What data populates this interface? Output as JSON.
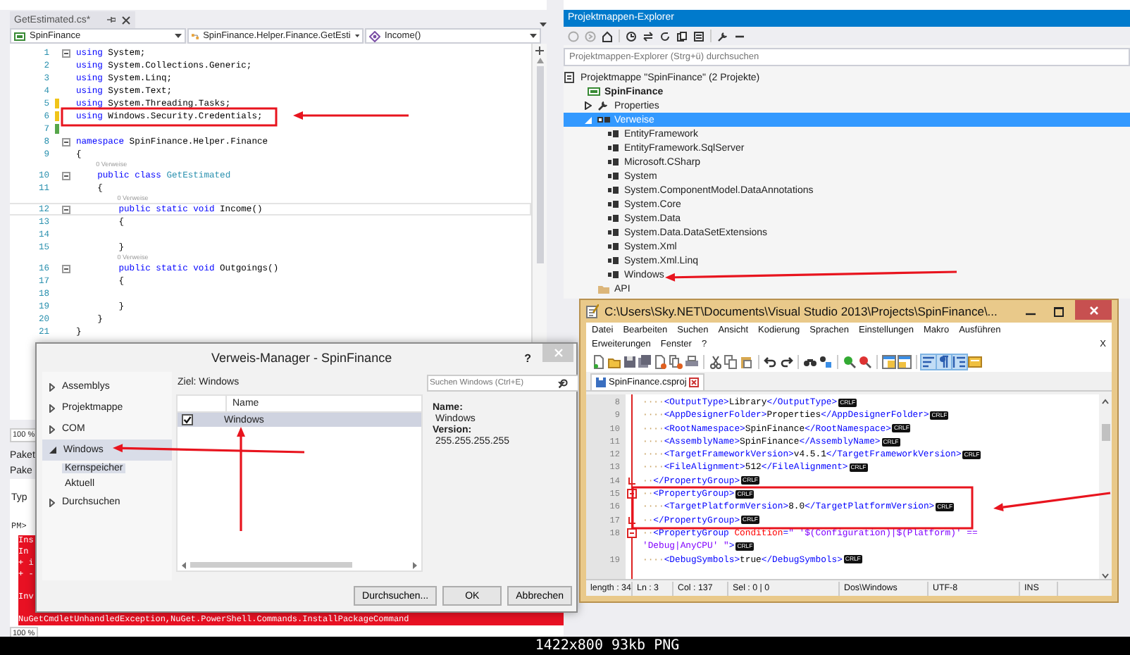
{
  "editor": {
    "tab": "GetEstimated.cs*",
    "nav": [
      {
        "kind": "project",
        "label": "SpinFinance"
      },
      {
        "kind": "class",
        "label": "SpinFinance.Helper.Finance.GetEsti"
      },
      {
        "kind": "method",
        "label": "Income()"
      }
    ],
    "lines": [
      {
        "kind": "code",
        "number": "1",
        "fold": true,
        "changed": false,
        "current": false,
        "tokens": [
          {
            "kind": "kw",
            "text": "using"
          },
          {
            "kind": "text",
            "text": " System;"
          }
        ]
      },
      {
        "kind": "code",
        "number": "2",
        "fold": false,
        "changed": false,
        "current": false,
        "tokens": [
          {
            "kind": "kw",
            "text": "using"
          },
          {
            "kind": "text",
            "text": " System.Collections.Generic;"
          }
        ]
      },
      {
        "kind": "code",
        "number": "3",
        "fold": false,
        "changed": false,
        "current": false,
        "tokens": [
          {
            "kind": "kw",
            "text": "using"
          },
          {
            "kind": "text",
            "text": " System.Linq;"
          }
        ]
      },
      {
        "kind": "code",
        "number": "4",
        "fold": false,
        "changed": false,
        "current": false,
        "tokens": [
          {
            "kind": "kw",
            "text": "using"
          },
          {
            "kind": "text",
            "text": " System.Text;"
          }
        ]
      },
      {
        "kind": "code",
        "number": "5",
        "fold": false,
        "changed": true,
        "saved": false,
        "current": false,
        "tokens": [
          {
            "kind": "kw",
            "text": "using"
          },
          {
            "kind": "text",
            "text": " System.Threading.Tasks;"
          }
        ]
      },
      {
        "kind": "code",
        "number": "6",
        "fold": false,
        "changed": true,
        "saved": false,
        "current": false,
        "tokens": [
          {
            "kind": "kw",
            "text": "using"
          },
          {
            "kind": "text",
            "text": " Windows.Security.Credentials;"
          }
        ]
      },
      {
        "kind": "code",
        "number": "7",
        "fold": false,
        "changed": true,
        "saved": true,
        "current": false
      },
      {
        "kind": "code",
        "number": "8",
        "fold": true,
        "changed": false,
        "current": false,
        "tokens": [
          {
            "kind": "kw",
            "text": "namespace"
          },
          {
            "kind": "text",
            "text": " SpinFinance.Helper.Finance"
          }
        ]
      },
      {
        "kind": "code",
        "number": "9",
        "fold": false,
        "changed": false,
        "current": false,
        "tokens": [
          {
            "kind": "text",
            "text": "{"
          }
        ]
      },
      {
        "kind": "lens",
        "text": "0 Verweise"
      },
      {
        "kind": "code",
        "number": "10",
        "fold": true,
        "changed": false,
        "current": false,
        "tokens": [
          {
            "kind": "kw",
            "text": "    public class "
          },
          {
            "kind": "type",
            "text": "GetEstimated"
          }
        ]
      },
      {
        "kind": "code",
        "number": "11",
        "fold": false,
        "changed": false,
        "current": false,
        "tokens": [
          {
            "kind": "text",
            "text": "    {"
          }
        ]
      },
      {
        "kind": "lens",
        "text": "0 Verweise"
      },
      {
        "kind": "code",
        "number": "12",
        "fold": true,
        "changed": false,
        "current": true,
        "tokens": [
          {
            "kind": "kw",
            "text": "        public static void "
          },
          {
            "kind": "text",
            "text": "Income()"
          }
        ]
      },
      {
        "kind": "code",
        "number": "13",
        "fold": false,
        "changed": false,
        "current": false,
        "tokens": [
          {
            "kind": "text",
            "text": "        {"
          }
        ]
      },
      {
        "kind": "code",
        "number": "14",
        "fold": false,
        "changed": false,
        "current": false
      },
      {
        "kind": "code",
        "number": "15",
        "fold": false,
        "changed": false,
        "current": false,
        "tokens": [
          {
            "kind": "text",
            "text": "        }"
          }
        ]
      },
      {
        "kind": "lens",
        "text": "0 Verweise"
      },
      {
        "kind": "code",
        "number": "16",
        "fold": true,
        "changed": false,
        "current": false,
        "tokens": [
          {
            "kind": "kw",
            "text": "        public static void "
          },
          {
            "kind": "text",
            "text": "Outgoings()"
          }
        ]
      },
      {
        "kind": "code",
        "number": "17",
        "fold": false,
        "changed": false,
        "current": false,
        "tokens": [
          {
            "kind": "text",
            "text": "        {"
          }
        ]
      },
      {
        "kind": "code",
        "number": "18",
        "fold": false,
        "changed": false,
        "current": false
      },
      {
        "kind": "code",
        "number": "19",
        "fold": false,
        "changed": false,
        "current": false,
        "tokens": [
          {
            "kind": "text",
            "text": "        }"
          }
        ]
      },
      {
        "kind": "code",
        "number": "20",
        "fold": false,
        "changed": false,
        "current": false,
        "tokens": [
          {
            "kind": "text",
            "text": "    }"
          }
        ]
      },
      {
        "kind": "code",
        "number": "21",
        "fold": false,
        "changed": false,
        "current": false,
        "tokens": [
          {
            "kind": "text",
            "text": "}"
          }
        ]
      }
    ]
  },
  "output": {
    "zoom": "100 %",
    "tabs": [
      "Paket",
      "Pake"
    ],
    "type_label": "Typ",
    "lines": [
      {
        "kind": "prompt",
        "text": "PM>"
      },
      {
        "kind": "error",
        "text": "Ins"
      },
      {
        "kind": "error",
        "text": "In"
      },
      {
        "kind": "error",
        "text": "+ i"
      },
      {
        "kind": "error",
        "text": "+ -"
      },
      {
        "kind": "error-blank"
      },
      {
        "kind": "error",
        "text": "Inv"
      },
      {
        "kind": "error-blank"
      },
      {
        "kind": "error",
        "text": "NuGetCmdletUnhandledException,NuGet.PowerShell.Commands.InstallPackageCommand"
      }
    ],
    "footer_zoom": "100 %"
  },
  "explorer": {
    "title": "Projektmappen-Explorer",
    "search": {
      "placeholder": "Projektmappen-Explorer (Strg+ü) durchsuchen"
    },
    "tree": [
      {
        "label": "Projektmappe \"SpinFinance\" (2 Projekte)",
        "kind": "solution",
        "selected": false,
        "children": [
          {
            "label": "SpinFinance",
            "kind": "project",
            "startup": true,
            "selected": false,
            "children": [
              {
                "label": "Properties",
                "kind": "properties",
                "expanded": false,
                "selected": false
              },
              {
                "label": "Verweise",
                "kind": "references",
                "expanded": true,
                "selected": true,
                "children": [
                  {
                    "label": "EntityFramework",
                    "kind": "reference",
                    "selected": false
                  },
                  {
                    "label": "EntityFramework.SqlServer",
                    "kind": "reference",
                    "selected": false
                  },
                  {
                    "label": "Microsoft.CSharp",
                    "kind": "reference",
                    "selected": false
                  },
                  {
                    "label": "System",
                    "kind": "reference",
                    "selected": false
                  },
                  {
                    "label": "System.ComponentModel.DataAnnotations",
                    "kind": "reference",
                    "selected": false
                  },
                  {
                    "label": "System.Core",
                    "kind": "reference",
                    "selected": false
                  },
                  {
                    "label": "System.Data",
                    "kind": "reference",
                    "selected": false
                  },
                  {
                    "label": "System.Data.DataSetExtensions",
                    "kind": "reference",
                    "selected": false
                  },
                  {
                    "label": "System.Xml",
                    "kind": "reference",
                    "selected": false
                  },
                  {
                    "label": "System.Xml.Linq",
                    "kind": "reference",
                    "selected": false
                  },
                  {
                    "label": "Windows",
                    "kind": "reference",
                    "selected": false
                  }
                ]
              },
              {
                "label": "API",
                "kind": "folder",
                "selected": false
              }
            ]
          }
        ]
      }
    ]
  },
  "dialog": {
    "title": "Verweis-Manager - SpinFinance",
    "help": "?",
    "nav": [
      {
        "label": "Assemblys",
        "expanded": false,
        "selected": false
      },
      {
        "label": "Projektmappe",
        "expanded": false,
        "selected": false
      },
      {
        "label": "COM",
        "expanded": false,
        "selected": false
      },
      {
        "label": "Windows",
        "expanded": true,
        "selected": true,
        "children": [
          {
            "label": "Kernspeicher",
            "selected": true
          },
          {
            "label": "Aktuell",
            "selected": false
          }
        ]
      },
      {
        "label": "Durchsuchen",
        "expanded": false,
        "selected": false
      }
    ],
    "target": "Ziel: Windows",
    "columns": [
      "Name"
    ],
    "rows": [
      {
        "name": "Windows",
        "checked": true,
        "selected": true
      }
    ],
    "search": {
      "placeholder": "Suchen Windows (Ctrl+E)"
    },
    "details": [
      {
        "label": "Name:",
        "value": "Windows"
      },
      {
        "label": "Version:",
        "value": "255.255.255.255"
      }
    ],
    "buttons": [
      "Durchsuchen...",
      "OK",
      "Abbrechen"
    ]
  },
  "notepad": {
    "title": "C:\\Users\\Sky.NET\\Documents\\Visual Studio 2013\\Projects\\SpinFinance\\...",
    "menu": [
      [
        "Datei",
        "Bearbeiten",
        "Suchen",
        "Ansicht",
        "Kodierung",
        "Sprachen",
        "Einstellungen",
        "Makro",
        "Ausführen"
      ],
      [
        "Erweiterungen",
        "Fenster",
        "?"
      ]
    ],
    "menu_close": "X",
    "toolbar": [
      [
        {
          "kind": "new",
          "on": false
        },
        {
          "kind": "open",
          "on": false
        },
        {
          "kind": "save",
          "on": false
        },
        {
          "kind": "save-all",
          "on": false
        },
        {
          "kind": "close",
          "on": false
        },
        {
          "kind": "close-all",
          "on": false
        },
        {
          "kind": "print",
          "on": false
        }
      ],
      [
        {
          "kind": "cut",
          "on": false
        },
        {
          "kind": "copy",
          "on": false
        },
        {
          "kind": "paste",
          "on": false
        }
      ],
      [
        {
          "kind": "undo",
          "on": false
        },
        {
          "kind": "redo",
          "on": false
        }
      ],
      [
        {
          "kind": "find",
          "on": false
        },
        {
          "kind": "replace",
          "on": false
        }
      ],
      [
        {
          "kind": "zoom-in",
          "on": false
        },
        {
          "kind": "zoom-out",
          "on": false
        }
      ],
      [
        {
          "kind": "sync-v",
          "on": false
        },
        {
          "kind": "sync-h",
          "on": false
        }
      ],
      [
        {
          "kind": "wrap",
          "on": true
        },
        {
          "kind": "all-chars",
          "on": true
        },
        {
          "kind": "indent-guide",
          "on": true
        },
        {
          "kind": "map",
          "on": false
        }
      ]
    ],
    "tab": "SpinFinance.csproj",
    "lines": [
      {
        "number": "8",
        "fold_start": false,
        "fold_end": false,
        "tokens": [
          {
            "kind": "ws",
            "text": "····"
          },
          {
            "kind": "tag",
            "text": "<OutputType>"
          },
          {
            "kind": "text",
            "text": "Library"
          },
          {
            "kind": "tag",
            "text": "</OutputType>"
          },
          {
            "kind": "eol",
            "text": "CRLF"
          }
        ]
      },
      {
        "number": "9",
        "fold_start": false,
        "fold_end": false,
        "tokens": [
          {
            "kind": "ws",
            "text": "····"
          },
          {
            "kind": "tag",
            "text": "<AppDesignerFolder>"
          },
          {
            "kind": "text",
            "text": "Properties"
          },
          {
            "kind": "tag",
            "text": "</AppDesignerFolder>"
          },
          {
            "kind": "eol",
            "text": "CRLF"
          }
        ]
      },
      {
        "number": "10",
        "fold_start": false,
        "fold_end": false,
        "tokens": [
          {
            "kind": "ws",
            "text": "····"
          },
          {
            "kind": "tag",
            "text": "<RootNamespace>"
          },
          {
            "kind": "text",
            "text": "SpinFinance"
          },
          {
            "kind": "tag",
            "text": "</RootNamespace>"
          },
          {
            "kind": "eol",
            "text": "CRLF"
          }
        ]
      },
      {
        "number": "11",
        "fold_start": false,
        "fold_end": false,
        "tokens": [
          {
            "kind": "ws",
            "text": "····"
          },
          {
            "kind": "tag",
            "text": "<AssemblyName>"
          },
          {
            "kind": "text",
            "text": "SpinFinance"
          },
          {
            "kind": "tag",
            "text": "</AssemblyName>"
          },
          {
            "kind": "eol",
            "text": "CRLF"
          }
        ]
      },
      {
        "number": "12",
        "fold_start": false,
        "fold_end": false,
        "tokens": [
          {
            "kind": "ws",
            "text": "····"
          },
          {
            "kind": "tag",
            "text": "<TargetFrameworkVersion>"
          },
          {
            "kind": "text",
            "text": "v4.5.1"
          },
          {
            "kind": "tag",
            "text": "</TargetFrameworkVersion>"
          },
          {
            "kind": "eol",
            "text": "CRLF"
          }
        ]
      },
      {
        "number": "13",
        "fold_start": false,
        "fold_end": false,
        "tokens": [
          {
            "kind": "ws",
            "text": "····"
          },
          {
            "kind": "tag",
            "text": "<FileAlignment>"
          },
          {
            "kind": "text",
            "text": "512"
          },
          {
            "kind": "tag",
            "text": "</FileAlignment>"
          },
          {
            "kind": "eol",
            "text": "CRLF"
          }
        ]
      },
      {
        "number": "14",
        "fold_start": false,
        "fold_end": true,
        "tokens": [
          {
            "kind": "ws",
            "text": "··"
          },
          {
            "kind": "tag",
            "text": "</PropertyGroup>"
          },
          {
            "kind": "eol",
            "text": "CRLF"
          }
        ]
      },
      {
        "number": "15",
        "fold_start": true,
        "fold_end": false,
        "tokens": [
          {
            "kind": "ws",
            "text": "··"
          },
          {
            "kind": "tag",
            "text": "<PropertyGroup>"
          },
          {
            "kind": "eol",
            "text": "CRLF"
          }
        ]
      },
      {
        "number": "16",
        "fold_start": false,
        "fold_end": false,
        "tokens": [
          {
            "kind": "ws",
            "text": "····"
          },
          {
            "kind": "tag",
            "text": "<TargetPlatformVersion>"
          },
          {
            "kind": "text",
            "text": "8.0"
          },
          {
            "kind": "tag",
            "text": "</TargetPlatformVersion>"
          },
          {
            "kind": "eol",
            "text": "CRLF"
          }
        ]
      },
      {
        "number": "17",
        "fold_start": false,
        "fold_end": true,
        "tokens": [
          {
            "kind": "ws",
            "text": "··"
          },
          {
            "kind": "tag",
            "text": "</PropertyGroup>"
          },
          {
            "kind": "eol",
            "text": "CRLF"
          }
        ]
      },
      {
        "number": "18",
        "fold_start": true,
        "fold_end": false,
        "tokens": [
          {
            "kind": "ws",
            "text": "··"
          },
          {
            "kind": "tag",
            "text": "<PropertyGroup "
          },
          {
            "kind": "attr",
            "text": "Condition"
          },
          {
            "kind": "tag",
            "text": "="
          },
          {
            "kind": "str",
            "text": "\" '$(Configuration)|$(Platform)' =="
          }
        ],
        "wrapped": [
          {
            "kind": "str",
            "text": "'Debug|AnyCPU' \""
          },
          {
            "kind": "tag",
            "text": ">"
          },
          {
            "kind": "eol",
            "text": "CRLF"
          }
        ]
      },
      {
        "number": "19",
        "fold_start": false,
        "fold_end": false,
        "tokens": [
          {
            "kind": "ws",
            "text": "····"
          },
          {
            "kind": "tag",
            "text": "<DebugSymbols>"
          },
          {
            "kind": "text",
            "text": "true"
          },
          {
            "kind": "tag",
            "text": "</DebugSymbols>"
          },
          {
            "kind": "eol",
            "text": "CRLF"
          }
        ]
      }
    ],
    "status": [
      "length : 34",
      "Ln : 3",
      "Col : 137",
      "Sel : 0 | 0",
      "Dos\\Windows",
      "UTF-8",
      "INS"
    ]
  },
  "caption": "1422x800 93kb PNG"
}
